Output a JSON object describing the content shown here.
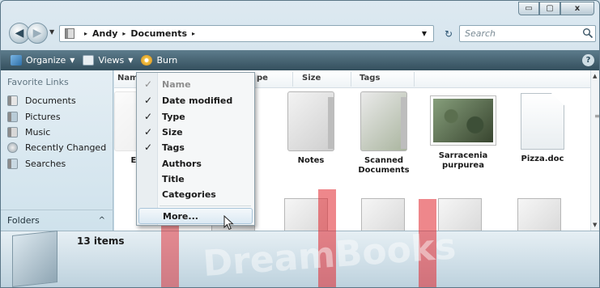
{
  "window": {
    "caption_buttons": {
      "minimize": "▭",
      "maximize": "▢",
      "close": "x"
    }
  },
  "address_bar": {
    "crumbs": [
      "Andy",
      "Documents"
    ],
    "separator": "▸"
  },
  "search": {
    "placeholder": "Search"
  },
  "toolbar": {
    "organize": "Organize",
    "views": "Views",
    "burn": "Burn",
    "help": "?"
  },
  "nav_pane": {
    "favorite_links_header": "Favorite Links",
    "items": [
      {
        "label": "Documents",
        "icon": "documents-icon"
      },
      {
        "label": "Pictures",
        "icon": "pictures-icon"
      },
      {
        "label": "Music",
        "icon": "music-icon"
      },
      {
        "label": "Recently Changed",
        "icon": "recently-changed-icon"
      },
      {
        "label": "Searches",
        "icon": "searches-icon"
      }
    ],
    "folders_label": "Folders",
    "folders_chevron": "^"
  },
  "columns": {
    "name": "Nam",
    "type": "pe",
    "size": "Size",
    "tags": "Tags"
  },
  "files": [
    {
      "label": "Ele",
      "kind": "folder"
    },
    {
      "label": "Notes",
      "kind": "folder"
    },
    {
      "label": "Scanned Documents",
      "kind": "folder"
    },
    {
      "label": "Sarracenia purpurea",
      "kind": "photo"
    },
    {
      "label": "Pizza.doc",
      "kind": "document"
    }
  ],
  "column_menu": {
    "items": [
      {
        "label": "Name",
        "checked": true,
        "disabled": true,
        "check": "✓"
      },
      {
        "label": "Date modified",
        "checked": true,
        "check": "✓"
      },
      {
        "label": "Type",
        "checked": true,
        "check": "✓"
      },
      {
        "label": "Size",
        "checked": true,
        "check": "✓"
      },
      {
        "label": "Tags",
        "checked": true,
        "check": "✓"
      },
      {
        "label": "Authors",
        "checked": false,
        "check": ""
      },
      {
        "label": "Title",
        "checked": false,
        "check": ""
      },
      {
        "label": "Categories",
        "checked": false,
        "check": ""
      },
      {
        "label": "More...",
        "checked": false,
        "check": ""
      }
    ]
  },
  "details": {
    "item_count": "13 items"
  },
  "watermark_text": "DreamBooks",
  "colors": {
    "toolbar": "#344f5d",
    "accent": "#e0242c",
    "menu_hover": "#dbe9f3"
  }
}
